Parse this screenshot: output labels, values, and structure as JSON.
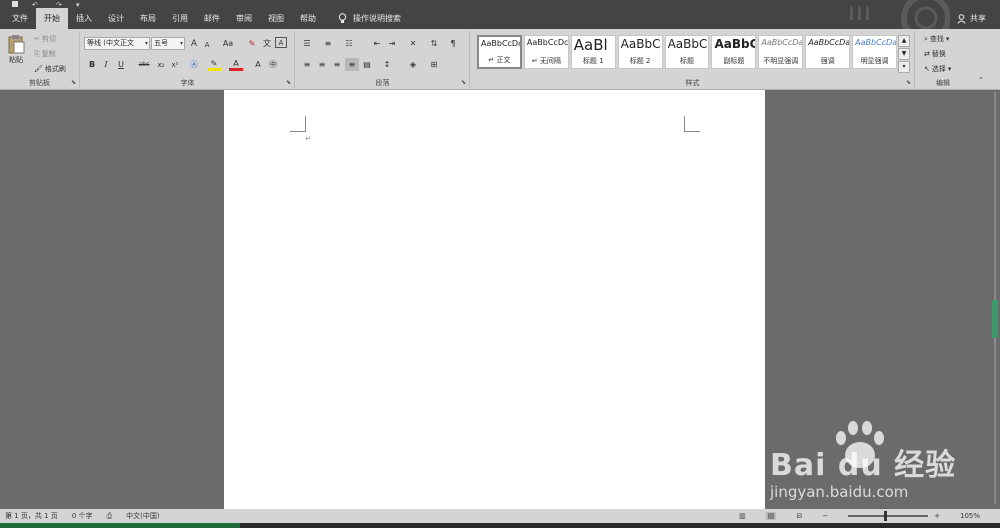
{
  "tabs": [
    "文件",
    "开始",
    "插入",
    "设计",
    "布局",
    "引用",
    "邮件",
    "审阅",
    "视图",
    "帮助"
  ],
  "active_tab": "开始",
  "tell_me": "操作说明搜索",
  "share": "共享",
  "clipboard": {
    "paste": "粘贴",
    "cut": "剪切",
    "copy": "复制",
    "format_painter": "格式刷",
    "label": "剪贴板"
  },
  "font": {
    "name": "等线 (中文正文",
    "size": "五号",
    "grow": "A",
    "shrink": "A",
    "case": "Aa",
    "bold": "B",
    "italic": "I",
    "underline": "U",
    "strike": "abc",
    "subscript": "x₂",
    "superscript": "x²",
    "label": "字体"
  },
  "paragraph": {
    "label": "段落"
  },
  "styles": {
    "label": "样式",
    "items": [
      {
        "sample": "AaBbCcDc",
        "name": "↵ 正文"
      },
      {
        "sample": "AaBbCcDc",
        "name": "↵ 无间隔"
      },
      {
        "sample": "AaBl",
        "name": "标题 1"
      },
      {
        "sample": "AaBbC",
        "name": "标题 2"
      },
      {
        "sample": "AaBbC",
        "name": "标题"
      },
      {
        "sample": "AaBbC",
        "name": "副标题"
      },
      {
        "sample": "AaBbCcDa",
        "name": "不明显强调"
      },
      {
        "sample": "AaBbCcDa",
        "name": "强调"
      },
      {
        "sample": "AaBbCcDa",
        "name": "明显强调"
      }
    ]
  },
  "editing": {
    "find": "查找",
    "replace": "替换",
    "select": "选择",
    "label": "编辑"
  },
  "document": {
    "paragraph_mark": "↵"
  },
  "status": {
    "page": "第 1 页，共 1 页",
    "words": "0 个字",
    "language": "中文(中国)",
    "zoom": "105%"
  },
  "watermark": {
    "brand": "Bai du 经验",
    "url": "jingyan.baidu.com"
  },
  "colors": {
    "ribbon": "#d4d4d4",
    "tabbar": "#444444",
    "workspace": "#6b6b6b",
    "accent": "#1f6b3e"
  }
}
